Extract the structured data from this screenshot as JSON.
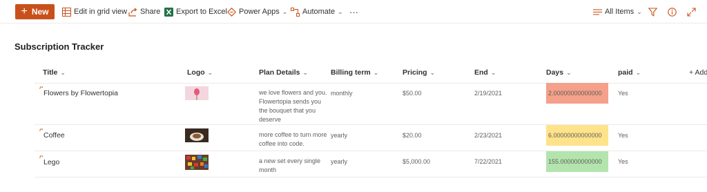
{
  "commandbar": {
    "new_label": "New",
    "edit_grid_label": "Edit in grid view",
    "share_label": "Share",
    "export_label": "Export to Excel",
    "powerapps_label": "Power Apps",
    "automate_label": "Automate",
    "more_label": "···",
    "view_label": "All Items"
  },
  "list": {
    "title": "Subscription Tracker",
    "columns": [
      "Title",
      "Logo",
      "Plan Details",
      "Billing term",
      "Pricing",
      "End",
      "Days",
      "paid"
    ],
    "add_column_label": "+ Add column"
  },
  "rows": [
    {
      "title": "Flowers by Flowertopia",
      "logo_icon": "pink-tulip-image",
      "plan": "we love flowers and you. Flowertopia sends you the bouquet that you deserve",
      "billing": "monthly",
      "pricing": "$50.00",
      "end": "2/19/2021",
      "days": "2.00000000000000",
      "days_color": "#f4a08a",
      "paid": "Yes"
    },
    {
      "title": "Coffee",
      "logo_icon": "coffee-cup-image",
      "plan": "more coffee to turn more coffee into code.",
      "billing": "yearly",
      "pricing": "$20.00",
      "end": "2/23/2021",
      "days": "6.00000000000000",
      "days_color": "#ffe38a",
      "paid": "Yes"
    },
    {
      "title": "Lego",
      "logo_icon": "lego-bricks-image",
      "plan": "a new set every single month",
      "billing": "yearly",
      "pricing": "$5,000.00",
      "end": "7/22/2021",
      "days": "155.000000000000",
      "days_color": "#b3e4ad",
      "paid": "Yes"
    }
  ],
  "colors": {
    "accent": "#c8511b",
    "excel_green": "#217346"
  }
}
